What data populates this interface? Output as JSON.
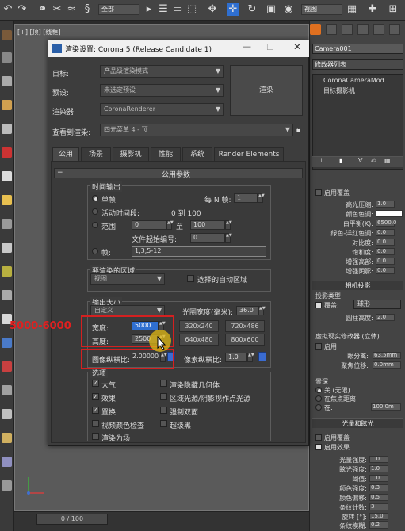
{
  "toolbar": {
    "selection_filter": "全部",
    "view_combo": "视图"
  },
  "viewport": {
    "label": "[+] [顶] [线框]",
    "timeline": "0 / 100"
  },
  "command_panel": {
    "object_name": "Camera001",
    "modifier_list": "修改器列表",
    "stack_items": [
      "CoronaCameraMod",
      "目标摄影机"
    ],
    "rows": [
      {
        "label": "启用覆盖"
      },
      {
        "label": "高光压缩:",
        "value": "1.0"
      },
      {
        "label": "颜色色调:"
      },
      {
        "label": "白平衡(K):",
        "value": "6500.0"
      },
      {
        "label": "绿色-洋红色调:",
        "value": "0.0"
      },
      {
        "label": "对比度:",
        "value": "0.0"
      },
      {
        "label": "饱和度:",
        "value": "0.0"
      },
      {
        "label": "增强高部:",
        "value": "0.0"
      },
      {
        "label": "增强阴影:",
        "value": "0.0"
      }
    ],
    "camera_projection_header": "相机投影",
    "projection_type_label": "投影类型",
    "override_label": "覆盖:",
    "projection_value": "球形",
    "cylinder_height_label": "圆柱高度:",
    "cylinder_height_value": "2.0",
    "vr_header": "虚拟现实修改器 (立体)",
    "vr_enable": "启用",
    "eye_distance_label": "眼分离:",
    "eye_distance_value": "63.5mm",
    "convergence_label": "聚焦位移:",
    "convergence_value": "0.0mm",
    "dof_header": "景深",
    "dof_options": [
      "关 (无限)",
      "在焦点距离",
      "在:"
    ],
    "dof_value": "100.0m",
    "bloom_header": "光量和眩光",
    "bloom_rows": [
      {
        "label": "启用覆盖"
      },
      {
        "label": "启用效果"
      },
      {
        "label": "光量强度:",
        "value": "1.0"
      },
      {
        "label": "眩光强度:",
        "value": "1.0"
      },
      {
        "label": "阈值:",
        "value": "1.0"
      },
      {
        "label": "颜色强度:",
        "value": "0.3"
      },
      {
        "label": "颜色偏移:",
        "value": "0.5"
      },
      {
        "label": "条纹计数:",
        "value": "3"
      },
      {
        "label": "旋转 [°]:",
        "value": "15.0"
      },
      {
        "label": "条纹模糊:",
        "value": "0.2"
      }
    ]
  },
  "dialog": {
    "title": "渲染设置: Corona 5 (Release Candidate 1)",
    "target_label": "目标:",
    "target_value": "产品级渲染模式",
    "preset_label": "预设:",
    "preset_value": "未选定预设",
    "renderer_label": "渲染器:",
    "renderer_value": "CoronaRenderer",
    "render_button": "渲染",
    "view_label": "查看到渲染:",
    "view_value": "四元菜单 4 - 顶",
    "tabs": [
      "公用",
      "场景",
      "摄影机",
      "性能",
      "系统",
      "Render Elements"
    ],
    "rollout_title": "公用参数",
    "time_output": {
      "title": "时间输出",
      "single": "单帧",
      "every_n": "每 N 帧:",
      "every_n_value": "1",
      "active_segment": "活动时间段:",
      "active_range": "0 到 100",
      "range": "范围:",
      "range_from": "0",
      "range_to_label": "至",
      "range_to": "100",
      "file_start": "文件起始编号:",
      "file_start_value": "0",
      "frames": "帧:",
      "frames_value": "1,3,5-12"
    },
    "render_area": {
      "title": "要渲染的区域",
      "value": "视图",
      "auto_region": "选择的自动区域"
    },
    "output_size": {
      "title": "输出大小",
      "preset": "自定义",
      "aperture_label": "光圈宽度(毫米):",
      "aperture_value": "36.0",
      "width_label": "宽度:",
      "width_value": "5000",
      "height_label": "高度:",
      "height_value": "2500",
      "sizes": [
        "320x240",
        "720x486",
        "640x480",
        "800x600"
      ],
      "image_aspect_label": "图像纵横比:",
      "image_aspect_value": "2.00000",
      "pixel_aspect_label": "像素纵横比:",
      "pixel_aspect_value": "1.0"
    },
    "options": {
      "title": "选项",
      "items": [
        {
          "label": "大气",
          "checked": true
        },
        {
          "label": "渲染隐藏几何体",
          "checked": false
        },
        {
          "label": "效果",
          "checked": true
        },
        {
          "label": "区域光源/阴影视作点光源",
          "checked": false
        },
        {
          "label": "置换",
          "checked": true
        },
        {
          "label": "强制双面",
          "checked": false
        },
        {
          "label": "视频颜色检查",
          "checked": false
        },
        {
          "label": "超级黑",
          "checked": false
        },
        {
          "label": "渲染为场",
          "checked": false
        }
      ]
    }
  },
  "annotation": {
    "text": "5000-6000",
    "color": "#e02020"
  }
}
